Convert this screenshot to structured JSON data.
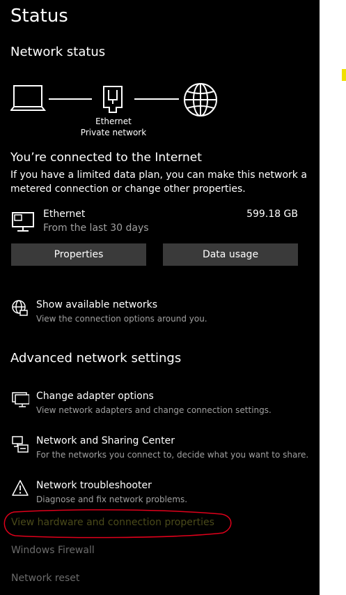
{
  "page_title": "Status",
  "network_status": {
    "heading": "Network status",
    "diagram": {
      "adapter_name": "Ethernet",
      "network_type": "Private network"
    },
    "connected_heading": "You’re connected to the Internet",
    "connected_desc_line1": "If you have a limited data plan, you can make this network a",
    "connected_desc_line2": "metered connection or change other properties.",
    "connection": {
      "name": "Ethernet",
      "period": "From the last 30 days",
      "usage": "599.18 GB"
    },
    "buttons": {
      "properties": "Properties",
      "data_usage": "Data usage"
    },
    "show_networks": {
      "title": "Show available networks",
      "desc": "View the connection options around you."
    }
  },
  "advanced": {
    "heading": "Advanced network settings",
    "items": [
      {
        "title": "Change adapter options",
        "desc": "View network adapters and change connection settings.",
        "icon": "adapter-icon"
      },
      {
        "title": "Network and Sharing Center",
        "desc": "For the networks you connect to, decide what you want to share.",
        "icon": "sharing-center-icon"
      },
      {
        "title": "Network troubleshooter",
        "desc": "Diagnose and fix network problems.",
        "icon": "warning-icon"
      }
    ],
    "links": {
      "hardware_properties": "View hardware and connection properties",
      "firewall": "Windows Firewall",
      "reset": "Network reset"
    }
  },
  "colors": {
    "background": "#000000",
    "button": "#3a3a3a",
    "muted_text": "#a0a0a0",
    "dim_link": "#6b6b6b",
    "annotation": "#e0001b",
    "accent": "#f0e000"
  }
}
